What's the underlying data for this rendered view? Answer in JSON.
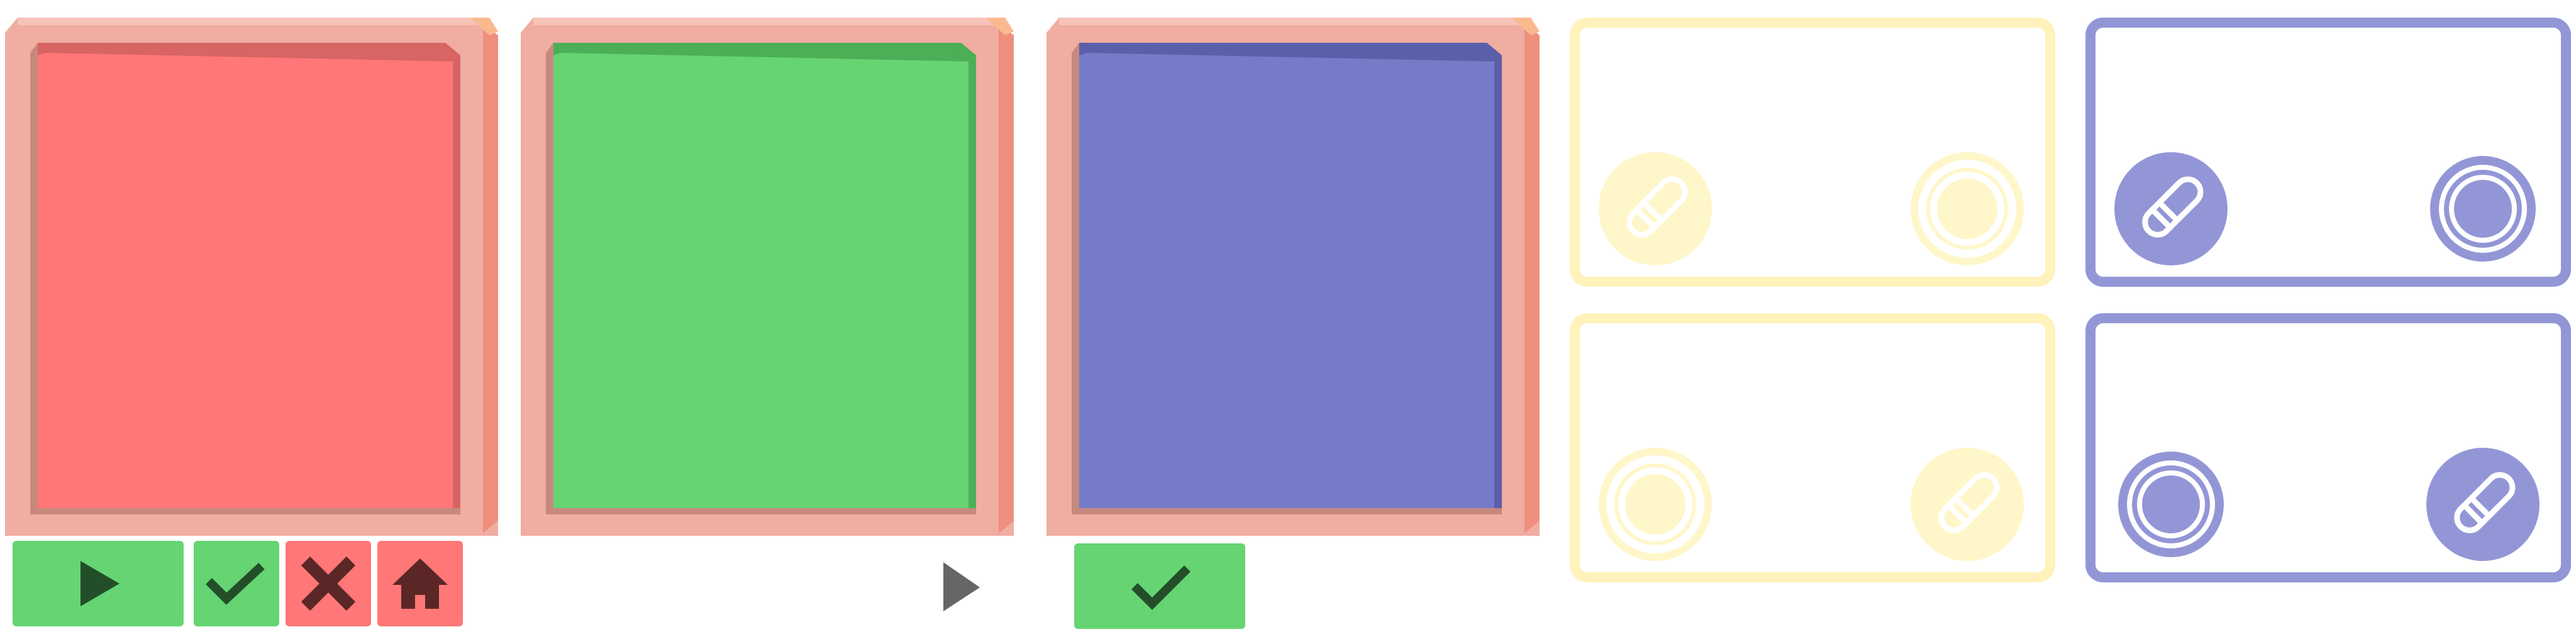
{
  "colors": {
    "frame_outer": "#F0ADA1",
    "frame_side": "#EF8F7E",
    "frame_top": "#F6C3B8",
    "corner": "#FBB990",
    "red_fill": "#FF7777",
    "red_dark": "#D86464",
    "green_fill": "#66D473",
    "green_dark": "#4CAF57",
    "blue_fill": "#757BC8",
    "blue_dark": "#5B5FAA",
    "inner_shadow": "#C7897E",
    "btn_green": "#66D473",
    "btn_red": "#FF7777",
    "btn_icon_green": "#224F2A",
    "btn_icon_red": "#5B2626",
    "arrow_gray": "#666666",
    "yellow_card": "#FFF6C9",
    "yellow_card_border": "#FFF2BC",
    "blue_card": "#9396D6",
    "white": "#FFFFFF"
  },
  "swatches": [
    {
      "color": "red"
    },
    {
      "color": "green"
    },
    {
      "color": "blue"
    }
  ],
  "buttons": {
    "play": {
      "icon": "play-icon"
    },
    "confirm": {
      "icon": "check-icon"
    },
    "cancel": {
      "icon": "close-icon"
    },
    "home": {
      "icon": "home-icon"
    },
    "next": {
      "icon": "arrow-right-icon"
    },
    "confirm_blue": {
      "icon": "check-icon"
    }
  },
  "cards": [
    {
      "theme": "yellow",
      "active_button": "left",
      "left_icon": "eraser-icon",
      "right_icon": "radio-icon"
    },
    {
      "theme": "blue",
      "active_button": "left",
      "left_icon": "eraser-icon",
      "right_icon": "radio-icon"
    },
    {
      "theme": "yellow",
      "active_button": "right",
      "left_icon": "radio-icon",
      "right_icon": "eraser-icon"
    },
    {
      "theme": "blue",
      "active_button": "right",
      "left_icon": "radio-icon",
      "right_icon": "eraser-icon"
    }
  ]
}
